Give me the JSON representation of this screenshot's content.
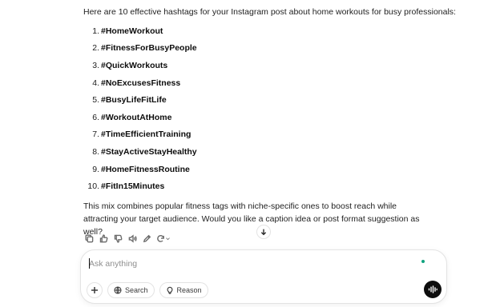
{
  "message": {
    "intro": "Here are 10 effective hashtags for your Instagram post about home workouts for busy professionals:",
    "hashtags": [
      {
        "num": "1.",
        "tag": "#HomeWorkout"
      },
      {
        "num": "2.",
        "tag": "#FitnessForBusyPeople"
      },
      {
        "num": "3.",
        "tag": "#QuickWorkouts"
      },
      {
        "num": "4.",
        "tag": "#NoExcusesFitness"
      },
      {
        "num": "5.",
        "tag": "#BusyLifeFitLife"
      },
      {
        "num": "6.",
        "tag": "#WorkoutAtHome"
      },
      {
        "num": "7.",
        "tag": "#TimeEfficientTraining"
      },
      {
        "num": "8.",
        "tag": "#StayActiveStayHealthy"
      },
      {
        "num": "9.",
        "tag": "#HomeFitnessRoutine"
      },
      {
        "num": "10.",
        "tag": "#FitIn15Minutes"
      }
    ],
    "outro": "This mix combines popular fitness tags with niche-specific ones to boost reach while attracting your target audience. Would you like a caption idea or post format suggestion as well?"
  },
  "actions": {
    "icons": [
      "copy-icon",
      "thumbs-up-icon",
      "thumbs-down-icon",
      "speaker-icon",
      "edit-icon",
      "regenerate-icon"
    ]
  },
  "composer": {
    "placeholder": "Ask anything",
    "search_label": "Search",
    "reason_label": "Reason",
    "status_color": "#10a37f"
  }
}
